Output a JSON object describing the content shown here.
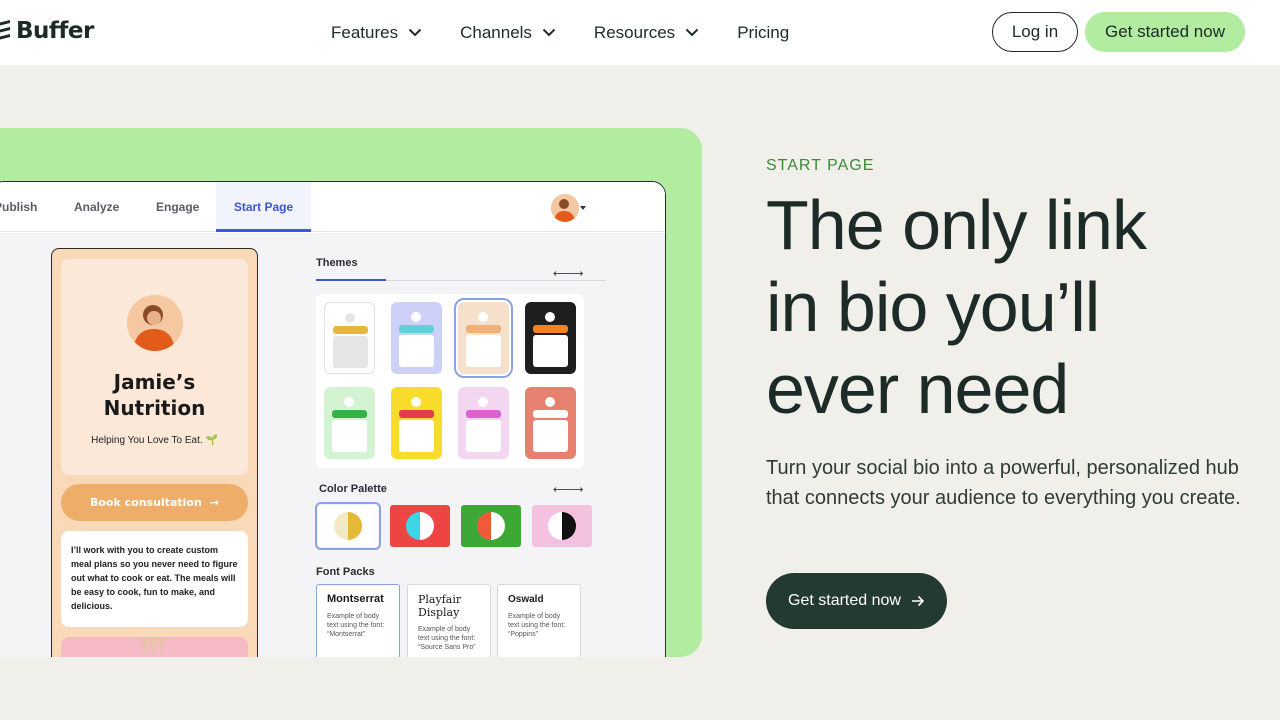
{
  "nav": {
    "brand": "Buffer",
    "items": [
      {
        "label": "Features",
        "has_dropdown": true
      },
      {
        "label": "Channels",
        "has_dropdown": true
      },
      {
        "label": "Resources",
        "has_dropdown": true
      },
      {
        "label": "Pricing",
        "has_dropdown": false
      }
    ],
    "login_label": "Log in",
    "cta_label": "Get started now"
  },
  "app": {
    "tabs": [
      "Publish",
      "Analyze",
      "Engage",
      "Start Page"
    ],
    "active_tab": "Start Page",
    "phone": {
      "name": "Jamie’s Nutrition",
      "tagline": "Helping You Love To Eat. 🌱",
      "button_label": "Book consultation",
      "card_text": "I’ll work with you to create custom meal plans so you never need to figure out what to cook or eat. The meals will be easy to cook, fun to make, and delicious."
    },
    "themes_label": "Themes",
    "color_palette_label": "Color Palette",
    "font_packs_label": "Font Packs",
    "font_packs": [
      {
        "name": "Montserrat",
        "desc": "Example of body text using the font: “Montserrat”"
      },
      {
        "name": "Playfair Display",
        "desc": "Example of body text using the font: “Source Sans Pro”"
      },
      {
        "name": "Oswald",
        "desc": "Example of body text using the font: “Poppins”"
      }
    ]
  },
  "hero": {
    "eyebrow": "START PAGE",
    "headline_line1": "The only link",
    "headline_line2": "in bio you’ll",
    "headline_line3": "ever need",
    "subcopy": "Turn your social bio into a powerful, personalized hub that connects your audience to everything you create.",
    "cta_label": "Get started now"
  },
  "colors": {
    "brand_green": "#b1eca0",
    "dark_green": "#233a33",
    "eyebrow_green": "#3b8a3a",
    "page_bg": "#f0efe9",
    "active_tab_blue": "#3d56d6"
  }
}
